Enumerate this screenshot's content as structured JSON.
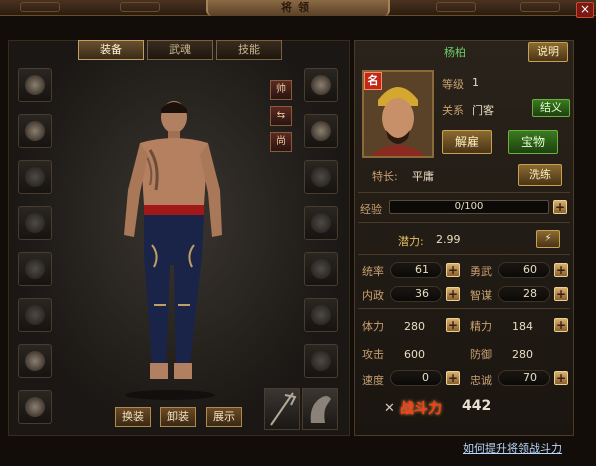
{
  "window": {
    "title": "将领",
    "close": "×"
  },
  "tabs": [
    "装备",
    "武魂",
    "技能"
  ],
  "side_buttons": [
    "帅",
    "⇆",
    "尚"
  ],
  "char_buttons": {
    "swap": "换装",
    "unequip": "卸装",
    "show": "展示"
  },
  "general": {
    "name": "杨柏",
    "explain_btn": "说明",
    "badge": "名",
    "level_label": "等级",
    "level": "1",
    "relation_label": "关系",
    "relation": "门客",
    "bond_btn": "结义",
    "dismiss_btn": "解雇",
    "treasure_btn": "宝物",
    "specialty_label": "特长:",
    "specialty": "平庸",
    "refine_btn": "洗练"
  },
  "exp": {
    "label": "经验",
    "value": "0/100",
    "fraction": 0.0
  },
  "potential": {
    "label": "潜力:",
    "value": "2.99"
  },
  "stats": [
    {
      "label": "统率",
      "value": "61"
    },
    {
      "label": "勇武",
      "value": "60"
    },
    {
      "label": "内政",
      "value": "36"
    },
    {
      "label": "智谋",
      "value": "28"
    }
  ],
  "attrs": [
    {
      "label": "体力",
      "value": "280"
    },
    {
      "label": "精力",
      "value": "184"
    },
    {
      "label": "攻击",
      "value": "600"
    },
    {
      "label": "防御",
      "value": "280"
    },
    {
      "label": "速度",
      "value": "0"
    },
    {
      "label": "忠诚",
      "value": "70"
    }
  ],
  "combat": {
    "label": "战斗力",
    "value": "442"
  },
  "help_link": "如何提升将领战斗力"
}
